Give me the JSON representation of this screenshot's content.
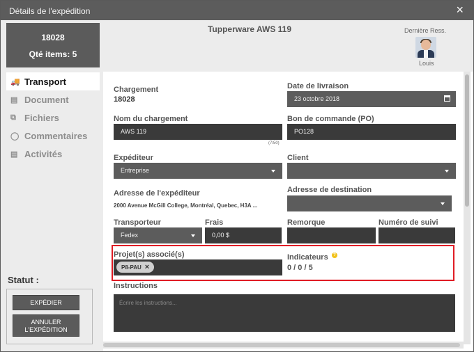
{
  "window": {
    "title": "Détails de l'expédition",
    "close_icon": "×"
  },
  "sidebar": {
    "shipment_number": "18028",
    "items_count": "Qté items: 5",
    "nav": [
      {
        "label": "Transport",
        "icon": "truck-icon",
        "glyph": "🚚"
      },
      {
        "label": "Document",
        "icon": "document-icon",
        "glyph": "▤"
      },
      {
        "label": "Fichiers",
        "icon": "files-icon",
        "glyph": "⧉"
      },
      {
        "label": "Commentaires",
        "icon": "comments-icon",
        "glyph": "◯"
      },
      {
        "label": "Activités",
        "icon": "activities-icon",
        "glyph": "▤"
      }
    ],
    "statut_label": "Statut :",
    "expedier_label": "EXPÉDIER",
    "annuler_label_line1": "ANNULER",
    "annuler_label_line2": "L'EXPÉDITION"
  },
  "header": {
    "title": "Tupperware AWS 119",
    "derniere_label": "Dernière Ress.",
    "user_name": "Louis"
  },
  "form": {
    "chargement_label": "Chargement",
    "chargement_value": "18028",
    "date_label": "Date de livraison",
    "date_value": "23 octobre 2018",
    "nom_label": "Nom du chargement",
    "nom_value": "AWS 119",
    "nom_counter": "(7/50)",
    "po_label": "Bon de commande (PO)",
    "po_value": "PO128",
    "expediteur_label": "Expéditeur",
    "expediteur_value": "Entreprise",
    "client_label": "Client",
    "client_value": "",
    "adresse_exp_label": "Adresse de l'expéditeur",
    "adresse_exp_value": "2000 Avenue McGill College, Montréal, Quebec, H3A ...",
    "adresse_dest_label": "Adresse de destination",
    "adresse_dest_value": "",
    "transporteur_label": "Transporteur",
    "transporteur_value": "Fedex",
    "frais_label": "Frais",
    "frais_value": "0,00 $",
    "remorque_label": "Remorque",
    "remorque_value": "",
    "suivi_label": "Numéro de suivi",
    "suivi_value": "",
    "projets_label": "Projet(s) associé(s)",
    "projet_chip": "P8-PAU",
    "indicateurs_label": "Indicateurs",
    "indicateurs_value": "0 / 0 / 5",
    "instructions_label": "Instructions",
    "instructions_placeholder": "Écrire les instructions..."
  },
  "colors": {
    "highlight": "#e01b24",
    "dark_field": "#3a3a3a",
    "help": "#f2c21a"
  }
}
